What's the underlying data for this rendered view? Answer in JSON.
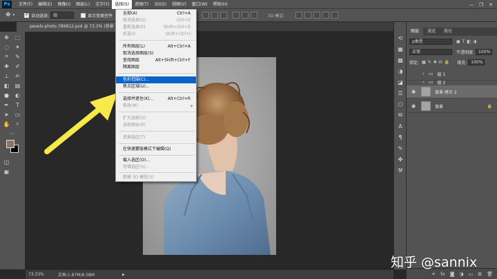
{
  "app": {
    "logo": "Ps"
  },
  "menubar": {
    "items": [
      "文件(F)",
      "编辑(E)",
      "图像(I)",
      "图层(L)",
      "文字(Y)",
      "选择(S)",
      "滤镜(T)",
      "3D(D)",
      "视图(V)",
      "窗口(W)",
      "帮助(H)"
    ],
    "active_index": 5
  },
  "window_controls": [
    "—",
    "❐",
    "✕"
  ],
  "options_bar": {
    "auto_select_label": "自动选择:",
    "auto_select_checked": true,
    "auto_select_value": "组",
    "show_transform_label": "显示变换控件",
    "show_transform_checked": false,
    "mode_label": "3D 模式:"
  },
  "document": {
    "tab_title": "pexels-photo-789812.psd @ 73.3% (背景 拷贝 2, RGB/8)"
  },
  "status": {
    "zoom": "73.33%",
    "doc": "文档:1.87M/8.58M"
  },
  "select_menu": {
    "items": [
      {
        "label": "全部(A)",
        "shortcut": "Ctrl+A",
        "disabled": false
      },
      {
        "label": "取消选择(D)",
        "shortcut": "Ctrl+D",
        "disabled": true
      },
      {
        "label": "重新选择(E)",
        "shortcut": "Shift+Ctrl+D",
        "disabled": true
      },
      {
        "label": "反选(I)",
        "shortcut": "Shift+Ctrl+I",
        "disabled": true
      },
      {
        "label": "所有图层(L)",
        "shortcut": "Alt+Ctrl+A",
        "disabled": false
      },
      {
        "label": "取消选择图层(S)",
        "shortcut": "",
        "disabled": false
      },
      {
        "label": "查找图层",
        "shortcut": "Alt+Shift+Ctrl+F",
        "disabled": false
      },
      {
        "label": "隔离图层",
        "shortcut": "",
        "disabled": false
      },
      {
        "label": "色彩范围(C)...",
        "shortcut": "",
        "disabled": false,
        "highlight": true
      },
      {
        "label": "焦点区域(U)...",
        "shortcut": "",
        "disabled": false
      },
      {
        "label": "选择并遮住(K)...",
        "shortcut": "Alt+Ctrl+R",
        "disabled": false
      },
      {
        "label": "修改(M)",
        "shortcut": "",
        "disabled": true,
        "submenu": true
      },
      {
        "label": "扩大选取(G)",
        "shortcut": "",
        "disabled": true
      },
      {
        "label": "选取相似(R)",
        "shortcut": "",
        "disabled": true
      },
      {
        "label": "变换选区(T)",
        "shortcut": "",
        "disabled": true
      },
      {
        "label": "在快速蒙版模式下编辑(Q)",
        "shortcut": "",
        "disabled": false
      },
      {
        "label": "载入选区(O)...",
        "shortcut": "",
        "disabled": false
      },
      {
        "label": "存储选区(V)...",
        "shortcut": "",
        "disabled": true
      },
      {
        "label": "新建 3D 模型(3)",
        "shortcut": "",
        "disabled": true
      }
    ]
  },
  "layers_panel": {
    "tabs": [
      "图层",
      "通道",
      "路径"
    ],
    "active_tab": 0,
    "filter_label": "ρ类型",
    "blend_mode": "正常",
    "opacity_label": "不透明度:",
    "opacity_value": "100%",
    "lock_label": "锁定:",
    "fill_label": "填充:",
    "fill_value": "100%",
    "layers": [
      {
        "name": "组 1",
        "type": "group",
        "visible": false,
        "selected": false
      },
      {
        "name": "组 2",
        "type": "group",
        "visible": false,
        "selected": false
      },
      {
        "name": "背景 拷贝 2",
        "type": "image",
        "visible": true,
        "selected": true
      },
      {
        "name": "背景",
        "type": "image",
        "visible": true,
        "selected": false,
        "locked": true
      }
    ],
    "bottom_icons": [
      "link-icon",
      "fx-icon",
      "mask-icon",
      "adjustment-icon",
      "folder-icon",
      "new-layer-icon",
      "trash-icon"
    ]
  },
  "watermark": "知乎 @sannix",
  "colors": {
    "highlight": "#0a64c8",
    "arrow": "#f7e94a",
    "foreground": "#8a7361",
    "background": "#000000"
  }
}
